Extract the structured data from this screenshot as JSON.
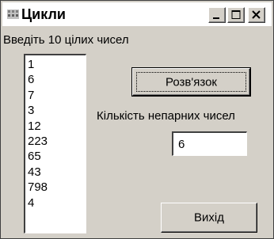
{
  "window": {
    "title": "Цикли",
    "icon": "app-icon",
    "controls": {
      "minimize": "minimize-icon",
      "maximize": "maximize-icon",
      "close": "close-icon"
    }
  },
  "form": {
    "prompt_label": "Введіть 10 цілих чисел",
    "numbers": [
      "1",
      "6",
      "7",
      "3",
      "12",
      "223",
      "65",
      "43",
      "798",
      "4"
    ],
    "solve_button": "Розв'язок",
    "odd_count_label": "Кількість непарних чисел",
    "odd_count_value": "6",
    "exit_button": "Вихід"
  },
  "colors": {
    "face": "#d4d0c8",
    "title_bg": "#ffffff",
    "field_bg": "#ffffff"
  }
}
